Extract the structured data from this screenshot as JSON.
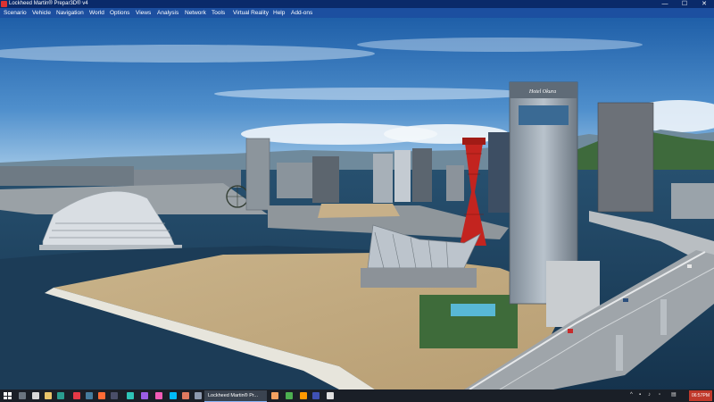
{
  "window": {
    "title": "Lockheed Martin® Prepar3D® v4",
    "controls": [
      "—",
      "☐",
      "✕"
    ]
  },
  "menu": [
    "Scenario",
    "Vehicle",
    "Navigation",
    "World",
    "Options",
    "Views",
    "Analysis",
    "Network",
    "Tools",
    "Virtual Reality",
    "Help",
    "Add-ons"
  ],
  "scene": {
    "tower_sign": "Hotel Okura"
  },
  "taskbar": {
    "active_app_label": "Lockheed Martin® Pr...",
    "clock": "06:57PM",
    "icons": [
      "windows-start-icon",
      "search-icon",
      "app-icon",
      "app-icon",
      "app-icon",
      "app-icon",
      "app-icon",
      "app-icon",
      "app-icon",
      "app-icon",
      "app-icon",
      "app-icon",
      "app-icon",
      "app-icon",
      "app-icon",
      "app-icon",
      "app-icon",
      "app-icon",
      "app-icon",
      "app-icon",
      "app-icon"
    ],
    "colors": {
      "bar": "#1a1f27",
      "clock_bg": "#c0392b",
      "accent": "#8ab4f8"
    }
  }
}
